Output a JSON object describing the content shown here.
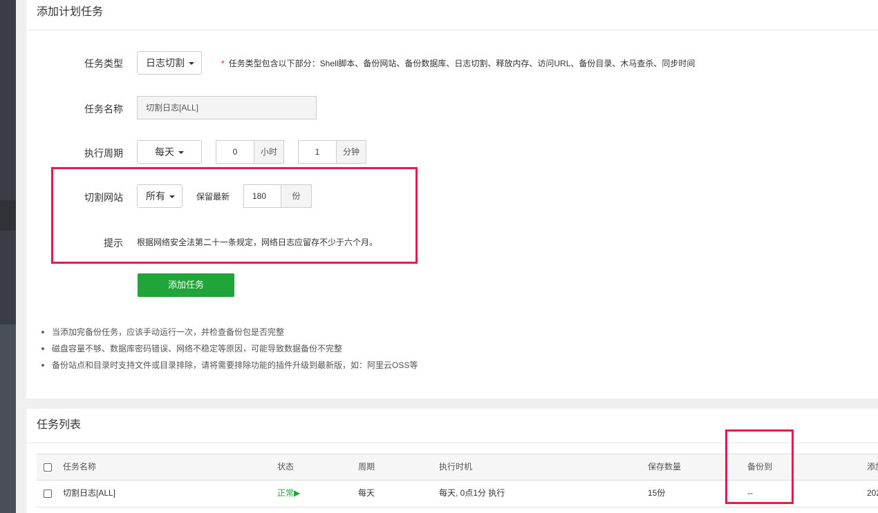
{
  "panel_add": {
    "title": "添加计划任务"
  },
  "form": {
    "task_type": {
      "label": "任务类型",
      "value": "日志切割",
      "note": "任务类型包含以下部分：Shell脚本、备份网站、备份数据库、日志切割、释放内存、访问URL、备份目录、木马查杀、同步时间"
    },
    "task_name": {
      "label": "任务名称",
      "value": "切割日志[ALL]"
    },
    "cycle": {
      "label": "执行周期",
      "value": "每天",
      "hour": "0",
      "hour_unit": "小时",
      "minute": "1",
      "minute_unit": "分钟"
    },
    "site": {
      "label": "切割网站",
      "value": "所有",
      "keep_label": "保留最新",
      "keep_value": "180",
      "keep_unit": "份"
    },
    "hint": {
      "label": "提示",
      "text": "根据网络安全法第二十一条规定，网络日志应留存不少于六个月。"
    },
    "submit_label": "添加任务"
  },
  "tips": [
    "当添加完备份任务，应该手动运行一次，并检查备份包是否完整",
    "磁盘容量不够、数据库密码错误、网络不稳定等原因，可能导致数据备份不完整",
    "备份站点和目录时支持文件或目录排除，请将需要排除功能的插件升级到最新版，如：阿里云OSS等"
  ],
  "panel_list": {
    "title": "任务列表"
  },
  "table": {
    "headers": {
      "name": "任务名称",
      "status": "状态",
      "cycle": "周期",
      "exec_time": "执行时机",
      "keep": "保存数量",
      "backup_to": "备份到",
      "added": "添加"
    },
    "rows": [
      {
        "name": "切割日志[ALL]",
        "status": "正常▶",
        "cycle": "每天",
        "exec_time": "每天, 0点1分 执行",
        "keep": "15份",
        "backup_to": "--",
        "added": "202"
      }
    ]
  },
  "colors": {
    "accent_green": "#20a53a",
    "highlight_red": "#e8194d"
  }
}
